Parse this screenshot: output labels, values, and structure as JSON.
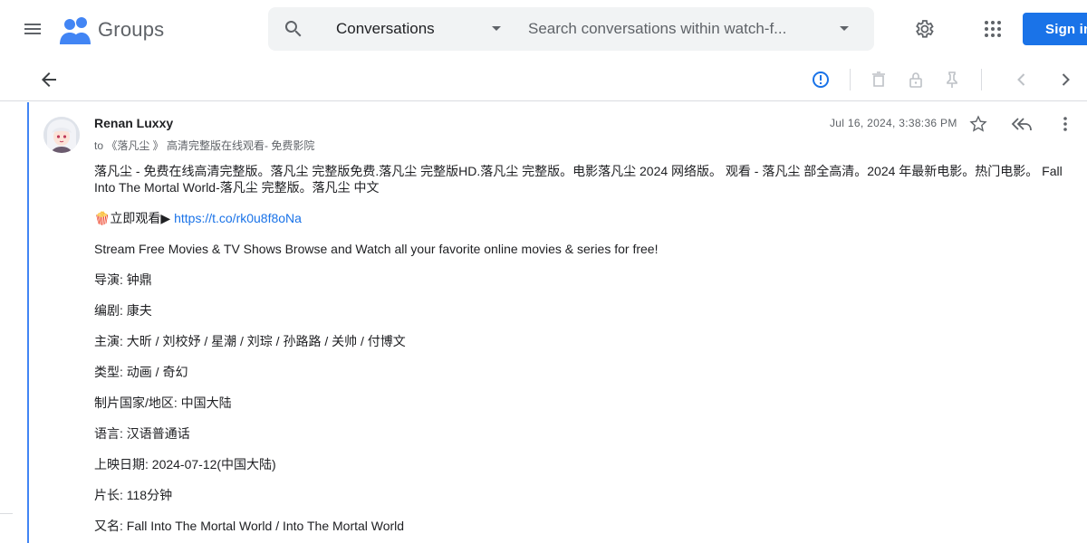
{
  "app": {
    "name": "Groups"
  },
  "search": {
    "scope_label": "Conversations",
    "placeholder": "Search conversations within watch-f..."
  },
  "header": {
    "signin_label": "Sign in"
  },
  "message": {
    "author": "Renan Luxxy",
    "recipient": "to 《落凡尘 》 高清完整版在线观看- 免费影院",
    "date": "Jul 16, 2024, 3:38:36 PM",
    "paragraphs": {
      "intro": "落凡尘 - 免费在线高清完整版。落凡尘 完整版免费.落凡尘 完整版HD.落凡尘 完整版。电影落凡尘 2024 网络版。 观看 - 落凡尘 部全高清。2024 年最新电影。热门电影。 Fall Into The Mortal World-落凡尘 完整版。落凡尘 中文",
      "watch_prefix": "🍿立即观看▶ ",
      "watch_link": "https://t.co/rk0u8f8oNa",
      "stream": "Stream Free Movies & TV Shows Browse and Watch all your favorite online movies & series for free!",
      "director": "导演: 钟鼎",
      "writer": "编剧: 康夫",
      "cast": "主演: 大昕 / 刘校妤 / 星潮 / 刘琮 / 孙路路 / 关帅 / 付博文",
      "genre": "类型: 动画 / 奇幻",
      "country": "制片国家/地区: 中国大陆",
      "language": "语言: 汉语普通话",
      "release": "上映日期: 2024-07-12(中国大陆)",
      "runtime": "片长: 118分钟",
      "aka": "又名: Fall Into The Mortal World / Into The Mortal World"
    }
  },
  "colors": {
    "accent": "#1a73e8",
    "rail": "#4285f4",
    "icon_gray": "#5f6368",
    "search_bg": "#f1f3f4"
  }
}
